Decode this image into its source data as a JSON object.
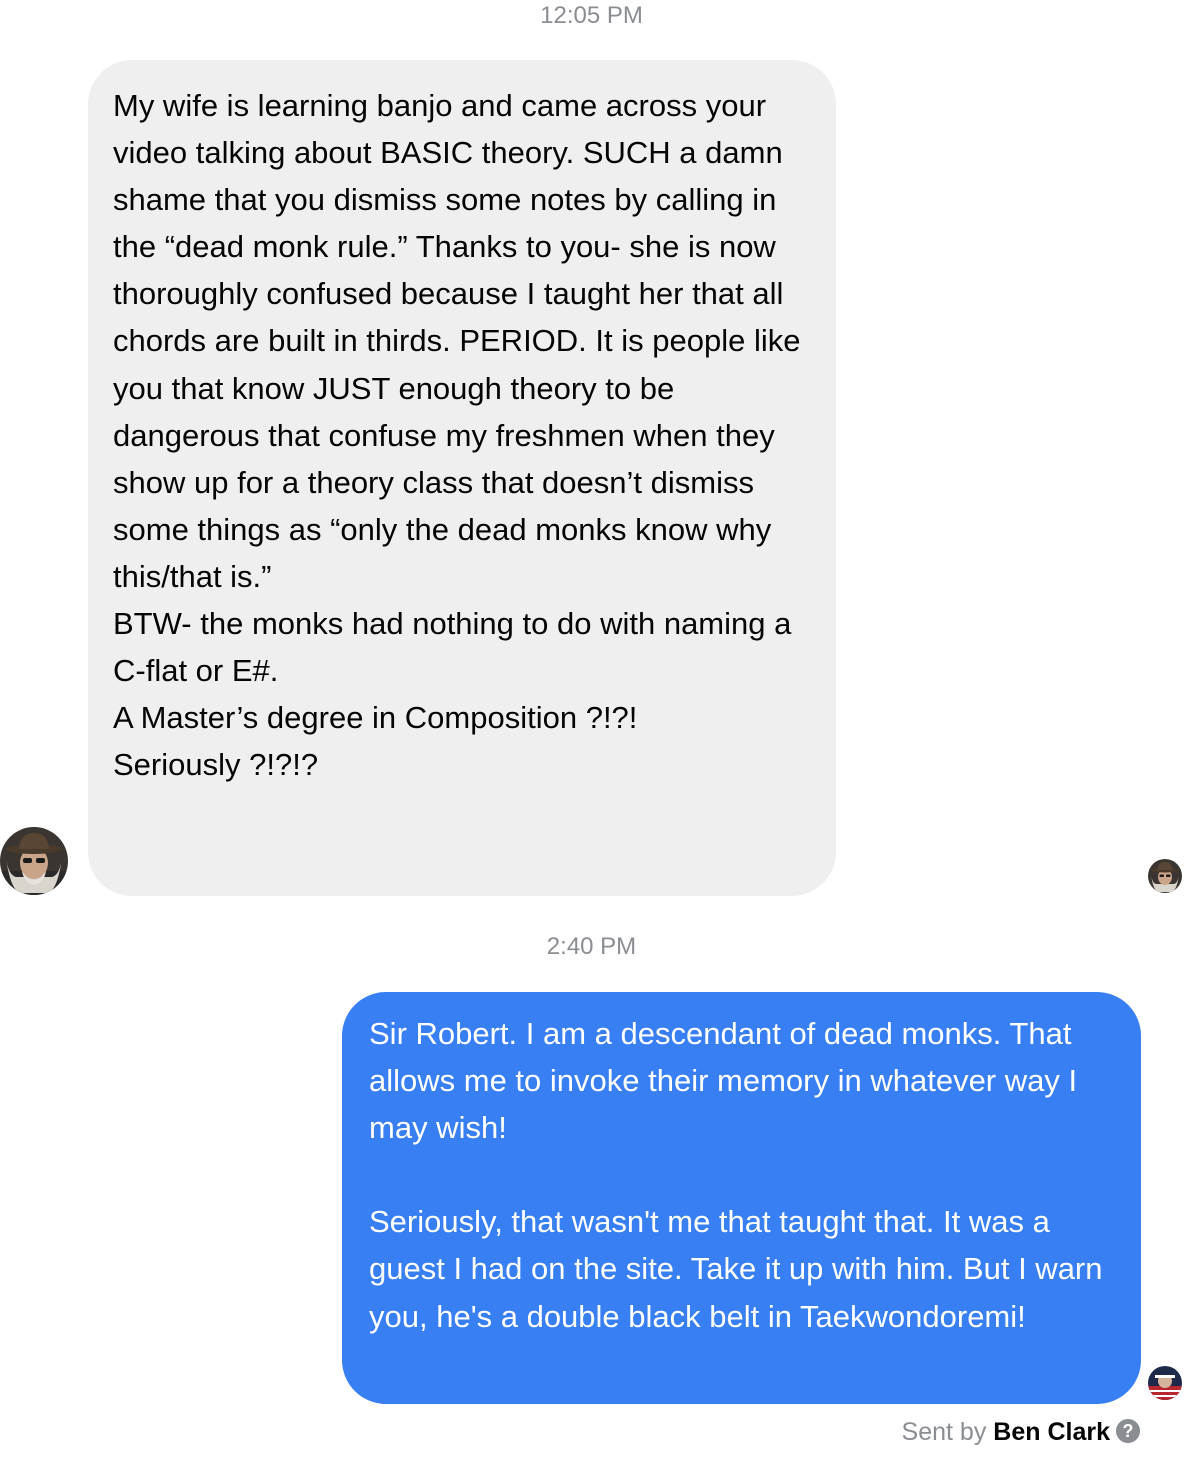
{
  "timestamps": {
    "first": "12:05 PM",
    "second": "2:40 PM"
  },
  "messages": {
    "incoming": {
      "text": "My wife is learning banjo and came across your video talking about BASIC theory. SUCH a damn shame that you dismiss some notes by calling in the “dead monk rule.” Thanks to you- she is now thoroughly confused because I taught her that all chords are built in thirds. PERIOD. It is people like you that know JUST enough theory to be dangerous that confuse my freshmen when they show up for a theory class that doesn’t dismiss some things as “only the dead monks know why this/that is.”\nBTW- the monks had nothing to do with naming a C-flat or E#.\nA Master’s degree in Composition ?!?!\nSeriously ?!?!?"
    },
    "outgoing": {
      "text": "Sir Robert. I am a descendant of dead monks. That allows me to invoke their memory in whatever way I may wish!\n\nSeriously, that wasn't me that taught that. It was a guest I had on the site. Take it up with him. But I warn you, he's a double black belt in Taekwondoremi!"
    }
  },
  "footer": {
    "sent_by_prefix": "Sent by ",
    "sent_by_name": "Ben Clark",
    "help_icon_glyph": "?"
  },
  "icons": {
    "sender_avatar": "avatar-icon",
    "seen_avatar": "avatar-icon",
    "help": "question-circle-icon"
  },
  "colors": {
    "incoming_bubble": "#efefef",
    "outgoing_bubble": "#377ff2",
    "timestamp_text": "#8a8d91",
    "message_text": "#050505",
    "outgoing_text": "#ffffff"
  }
}
